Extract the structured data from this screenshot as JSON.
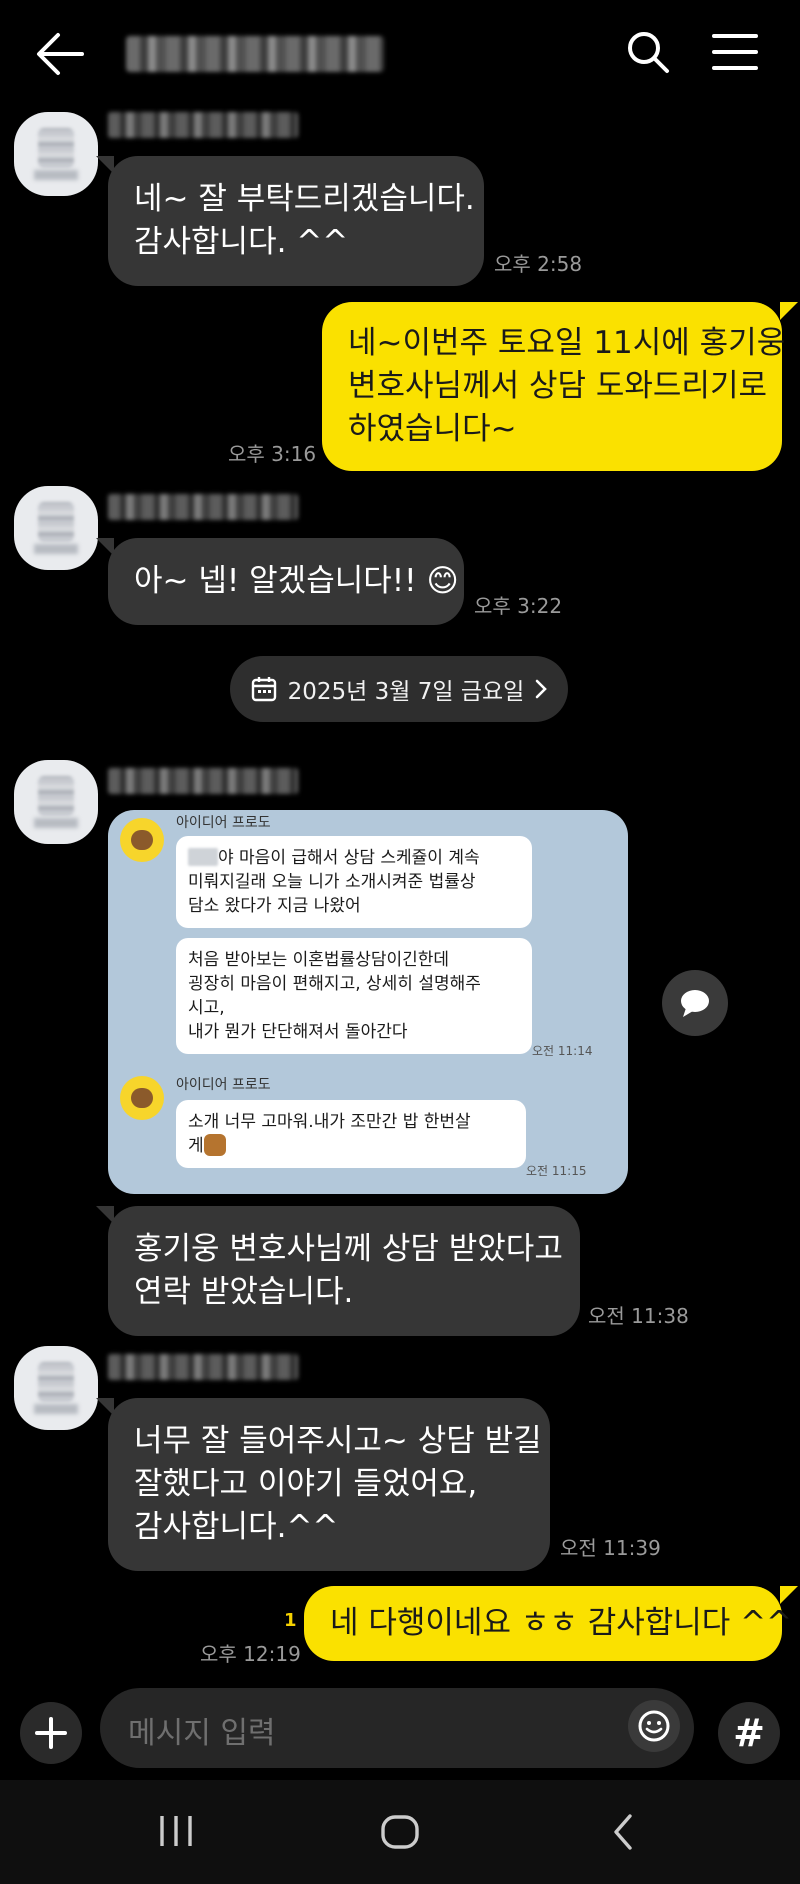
{
  "messages": [
    {
      "lines": [
        "네~ 잘 부탁드리겠습니다.",
        "감사합니다. ^^"
      ],
      "time": "오후 2:58"
    },
    {
      "lines": [
        "네~이번주 토요일 11시에 홍기웅",
        "변호사님께서 상담 도와드리기로",
        "하였습니다~"
      ],
      "time": "오후 3:16"
    },
    {
      "lines": [
        "아~ 넵!  알겠습니다!! 😊"
      ],
      "time": "오후 3:22"
    },
    {
      "lines": [
        "홍기웅 변호사님께 상담 받았다고",
        "연락 받았습니다."
      ],
      "time": "오전 11:38"
    },
    {
      "lines": [
        "너무 잘 들어주시고~ 상담 받길",
        "잘했다고 이야기 들었어요,",
        "감사합니다.^^"
      ],
      "time": "오전 11:39"
    },
    {
      "lines": [
        "네 다행이네요 ㅎㅎ 감사합니다 ^^"
      ],
      "time": "오후 12:19",
      "unread": "1"
    }
  ],
  "date_divider": "2025년 3월 7일 금요일",
  "screenshot": {
    "sender": "아이디어 프로도",
    "bubble1": [
      "야 마음이 급해서 상담 스케쥴이 계속",
      "미뤄지길래 오늘 니가 소개시켜준 법률상",
      "담소 왔다가 지금 나왔어"
    ],
    "bubble2": [
      "처음 받아보는 이혼법률상담이긴한데",
      "굉장히 마음이 편해지고, 상세히 설명해주",
      "시고,",
      "내가 뭔가 단단해져서 돌아간다"
    ],
    "time1": "오전 11:14",
    "bubble3": [
      "소개 너무 고마워.내가 조만간  밥 한번살",
      "게"
    ],
    "time2": "오전 11:15"
  },
  "input": {
    "placeholder": "메시지 입력"
  },
  "icons": [
    "back-arrow-icon",
    "search-icon",
    "menu-icon",
    "calendar-icon",
    "chevron-right-icon",
    "share-icon",
    "plus-icon",
    "emoji-icon",
    "hash-icon",
    "recent-apps-icon",
    "home-icon",
    "back-icon"
  ]
}
